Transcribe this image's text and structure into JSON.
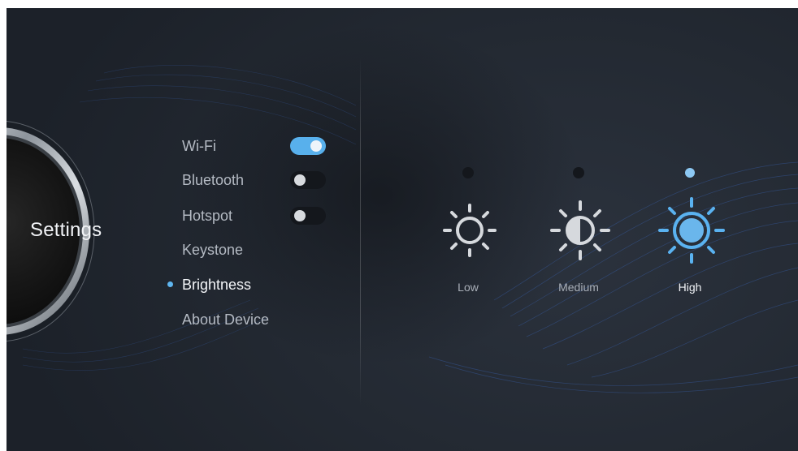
{
  "page": {
    "title": "Settings"
  },
  "menu": {
    "items": [
      {
        "label": "Wi-Fi",
        "toggle": "on"
      },
      {
        "label": "Bluetooth",
        "toggle": "off"
      },
      {
        "label": "Hotspot",
        "toggle": "off"
      },
      {
        "label": "Keystone"
      },
      {
        "label": "Brightness",
        "active": true
      },
      {
        "label": "About Device"
      }
    ]
  },
  "brightness": {
    "selected": "High",
    "levels": [
      {
        "label": "Low",
        "icon": "sun-outline-icon"
      },
      {
        "label": "Medium",
        "icon": "sun-half-icon"
      },
      {
        "label": "High",
        "icon": "sun-filled-icon"
      }
    ]
  },
  "colors": {
    "accent": "#58b0ec",
    "toggle_off": "#14171c",
    "text_active": "#f4f6f9",
    "text_inactive": "#b4bac3"
  }
}
